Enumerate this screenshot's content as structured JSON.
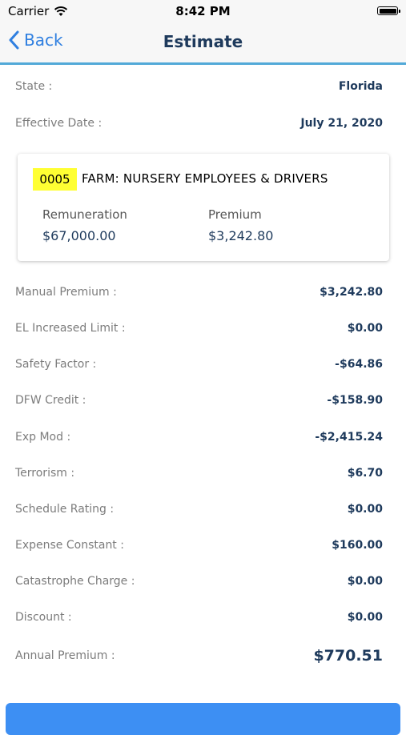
{
  "status_bar": {
    "carrier": "Carrier",
    "time": "8:42 PM"
  },
  "nav": {
    "back_label": "Back",
    "title": "Estimate"
  },
  "info": [
    {
      "label": "State :",
      "value": "Florida"
    },
    {
      "label": "Effective Date :",
      "value": "July 21, 2020"
    }
  ],
  "class_card": {
    "code": "0005",
    "description": "FARM: NURSERY EMPLOYEES & DRIVERS",
    "remuneration_label": "Remuneration",
    "remuneration_value": "$67,000.00",
    "premium_label": "Premium",
    "premium_value": "$3,242.80",
    "highlight_color": "#ffff33"
  },
  "breakdown": [
    {
      "label": "Manual Premium :",
      "value": "$3,242.80"
    },
    {
      "label": "EL Increased Limit :",
      "value": "$0.00"
    },
    {
      "label": "Safety Factor :",
      "value": "-$64.86"
    },
    {
      "label": "DFW Credit :",
      "value": "-$158.90"
    },
    {
      "label": "Exp Mod :",
      "value": "-$2,415.24"
    },
    {
      "label": "Terrorism :",
      "value": "$6.70"
    },
    {
      "label": "Schedule Rating :",
      "value": "$0.00"
    },
    {
      "label": "Expense Constant :",
      "value": "$160.00"
    },
    {
      "label": "Catastrophe Charge :",
      "value": "$0.00"
    },
    {
      "label": "Discount :",
      "value": "$0.00"
    }
  ],
  "annual": {
    "label": "Annual Premium :",
    "value": "$770.51"
  },
  "colors": {
    "accent": "#52a9d8",
    "link": "#2f7fe0",
    "value_text": "#1e3a5c",
    "button": "#3d8ff3"
  }
}
